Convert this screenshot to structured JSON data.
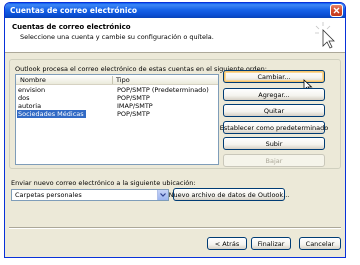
{
  "window": {
    "title": "Cuentas de correo electrónico"
  },
  "header": {
    "title": "Cuentas de correo electrónico",
    "subtitle": "Seleccione una cuenta y cambie su configuración o quítela."
  },
  "accounts": {
    "intro": "Outlook procesa el correo electrónico de estas cuentas en el siguiente orden:",
    "columns": [
      "Nombre",
      "Tipo"
    ],
    "rows": [
      {
        "name": "envision",
        "type": "POP/SMTP (Predeterminado)"
      },
      {
        "name": "dos",
        "type": "POP/SMTP"
      },
      {
        "name": "autoria",
        "type": "IMAP/SMTP"
      },
      {
        "name": "Sociedades Médicas",
        "type": "POP/SMTP"
      }
    ],
    "selected_row": 3
  },
  "side_buttons": {
    "change": "Cambiar...",
    "add": "Agregar...",
    "remove": "Quitar",
    "set_default": "Establecer como predeterminado",
    "up": "Subir",
    "down": "Bajar"
  },
  "delivery": {
    "label": "Enviar nuevo correo electrónico a la siguiente ubicación:",
    "selected": "Carpetas personales",
    "new_data_file": "Nuevo archivo de datos de Outlook..."
  },
  "footer": {
    "back": "< Atrás",
    "finish": "Finalizar",
    "cancel": "Cancelar"
  },
  "colors": {
    "titlebar": "#0a4fd4",
    "selection": "#316ac5",
    "dialog_bg": "#ece9d8"
  }
}
